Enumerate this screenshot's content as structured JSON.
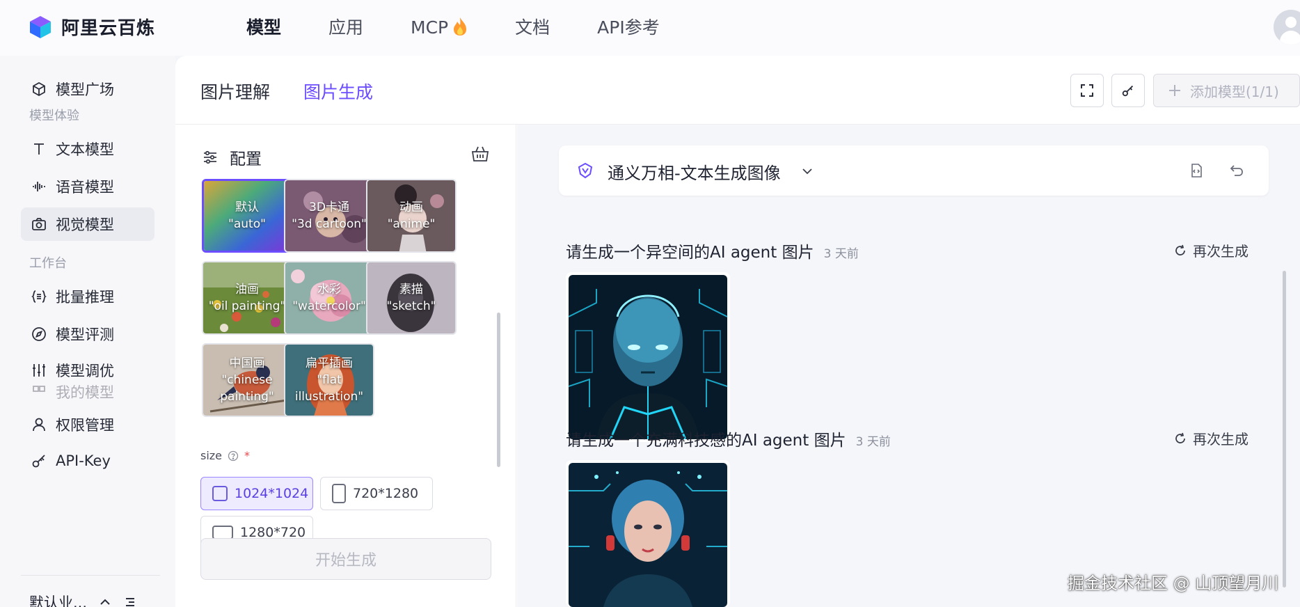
{
  "app": {
    "name": "阿里云百炼"
  },
  "nav": {
    "items": [
      {
        "label": "模型",
        "active": true
      },
      {
        "label": "应用",
        "active": false
      },
      {
        "label": "MCP",
        "active": false,
        "icon": "fire-icon"
      },
      {
        "label": "文档",
        "active": false
      },
      {
        "label": "API参考",
        "active": false
      }
    ]
  },
  "sidebar": {
    "top_item": {
      "label": "模型广场",
      "icon": "cube-icon"
    },
    "group_experience": "模型体验",
    "experience_items": [
      {
        "label": "文本模型",
        "icon": "text-icon",
        "active": false
      },
      {
        "label": "语音模型",
        "icon": "waveform-icon",
        "active": false
      },
      {
        "label": "视觉模型",
        "icon": "camera-icon",
        "active": true
      }
    ],
    "group_workspace": "工作台",
    "workspace_items": [
      {
        "label": "批量推理",
        "icon": "braces-list-icon"
      },
      {
        "label": "模型评测",
        "icon": "compass-icon"
      },
      {
        "label": "模型调优",
        "icon": "sliders-icon"
      },
      {
        "label": "我的模型",
        "icon": "model-icon"
      }
    ],
    "bottom_items": [
      {
        "label": "权限管理",
        "icon": "user-icon"
      },
      {
        "label": "API-Key",
        "icon": "key-icon"
      }
    ],
    "footer": {
      "label": "默认业...",
      "icon": "chevron-up-icon"
    }
  },
  "tabs": [
    {
      "label": "图片理解",
      "active": false
    },
    {
      "label": "图片生成",
      "active": true
    }
  ],
  "toolbar": {
    "add_model_label": "添加模型(1/1)"
  },
  "config": {
    "title": "配置",
    "styles": [
      {
        "name": "默认",
        "value": "\"auto\"",
        "selected": true
      },
      {
        "name": "3D卡通",
        "value": "\"3d cartoon\"",
        "selected": false
      },
      {
        "name": "动画",
        "value": "\"anime\"",
        "selected": false
      },
      {
        "name": "油画",
        "value": "\"oil painting\"",
        "selected": false
      },
      {
        "name": "水彩",
        "value": "\"watercolor\"",
        "selected": false
      },
      {
        "name": "素描",
        "value": "\"sketch\"",
        "selected": false
      },
      {
        "name": "中国画",
        "value": "\"chinese painting\"",
        "selected": false
      },
      {
        "name": "扁平插画",
        "value": "\"flat illustration\"",
        "selected": false
      }
    ],
    "size_label": "size",
    "required_mark": "*",
    "sizes": [
      {
        "label": "1024*1024",
        "selected": true
      },
      {
        "label": "720*1280",
        "selected": false
      },
      {
        "label": "1280*720",
        "selected": false
      }
    ],
    "start_label": "开始生成"
  },
  "chat": {
    "model_name": "通义万相-文本生成图像",
    "messages": [
      {
        "prompt": "请生成一个异空间的AI agent 图片",
        "time": "3 天前",
        "regen_label": "再次生成"
      },
      {
        "prompt": "请生成一个充满科技感的AI agent 图片",
        "time": "3 天前",
        "regen_label": "再次生成"
      }
    ]
  },
  "watermark": "掘金技术社区 @ 山顶望月川",
  "colors": {
    "accent": "#6c4dff",
    "selected_bg": "#eeebff"
  }
}
